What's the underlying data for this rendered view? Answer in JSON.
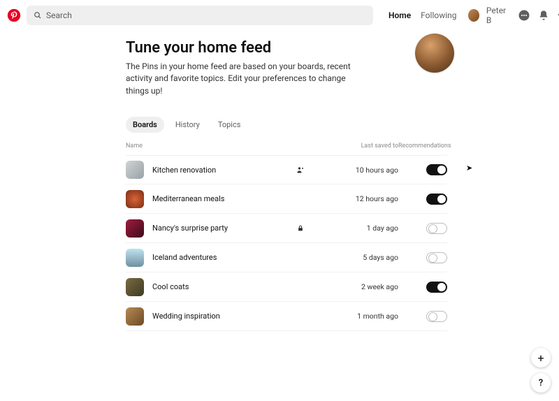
{
  "header": {
    "search_placeholder": "Search",
    "nav": {
      "home": "Home",
      "following": "Following"
    },
    "user_name": "Peter B"
  },
  "page": {
    "title": "Tune your home feed",
    "subtitle": "The Pins in your home feed are based on your boards, recent activity and favorite topics. Edit your preferences to change things up!"
  },
  "tabs": [
    {
      "label": "Boards",
      "active": true
    },
    {
      "label": "History",
      "active": false
    },
    {
      "label": "Topics",
      "active": false
    }
  ],
  "columns": {
    "name": "Name",
    "last": "Last saved to",
    "rec": "Recommendations"
  },
  "boards": [
    {
      "name": "Kitchen renovation",
      "indicator": "collab",
      "last": "10 hours ago",
      "on": true
    },
    {
      "name": "Mediterranean meals",
      "indicator": "",
      "last": "12 hours ago",
      "on": true
    },
    {
      "name": "Nancy's surprise party",
      "indicator": "private",
      "last": "1 day ago",
      "on": false
    },
    {
      "name": "Iceland adventures",
      "indicator": "",
      "last": "5 days ago",
      "on": false
    },
    {
      "name": "Cool coats",
      "indicator": "",
      "last": "2 week ago",
      "on": true
    },
    {
      "name": "Wedding inspiration",
      "indicator": "",
      "last": "1 month ago",
      "on": false
    }
  ],
  "fab": {
    "plus": "+",
    "help": "?"
  }
}
